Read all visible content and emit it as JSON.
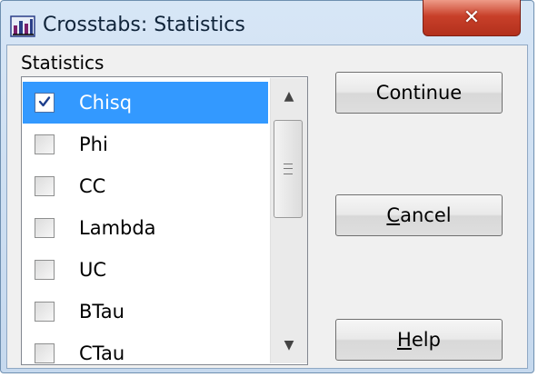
{
  "window": {
    "title": "Crosstabs: Statistics",
    "close_glyph": "✕"
  },
  "group": {
    "label": "Statistics"
  },
  "list": {
    "items": [
      {
        "label": "Chisq",
        "checked": true,
        "selected": true
      },
      {
        "label": "Phi",
        "checked": false,
        "selected": false
      },
      {
        "label": "CC",
        "checked": false,
        "selected": false
      },
      {
        "label": "Lambda",
        "checked": false,
        "selected": false
      },
      {
        "label": "UC",
        "checked": false,
        "selected": false
      },
      {
        "label": "BTau",
        "checked": false,
        "selected": false
      },
      {
        "label": "CTau",
        "checked": false,
        "selected": false
      }
    ]
  },
  "buttons": {
    "continue": {
      "label": "Continue",
      "accel": ""
    },
    "cancel": {
      "accel": "C",
      "rest": "ancel"
    },
    "help": {
      "accel": "H",
      "rest": "elp"
    }
  },
  "colors": {
    "selection": "#3399ff",
    "close_button": "#c8402a"
  }
}
